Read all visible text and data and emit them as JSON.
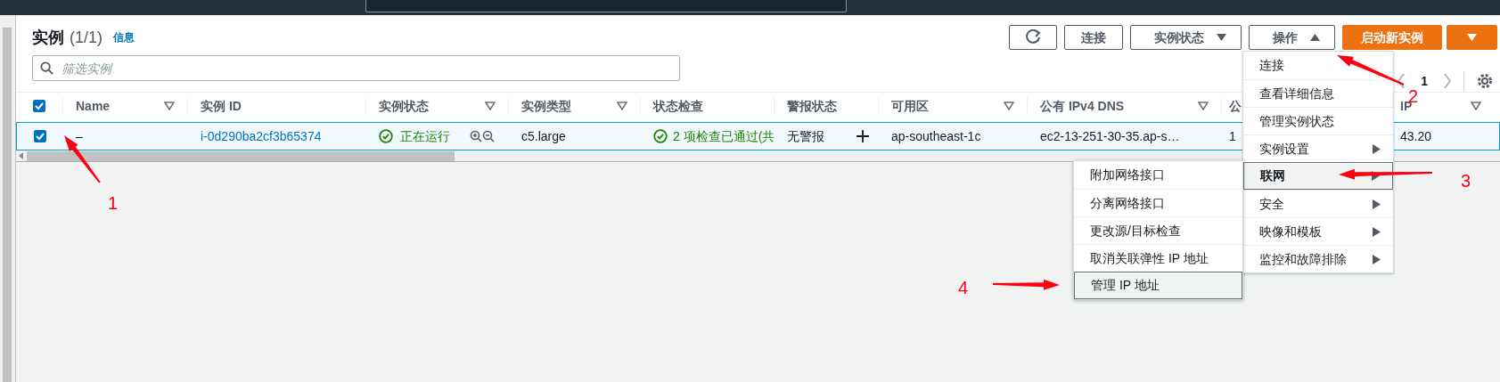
{
  "header": {
    "title": "实例",
    "count": "(1/1)",
    "info_link": "信息"
  },
  "toolbar": {
    "buttons": [
      {
        "kind": "refresh"
      },
      {
        "kind": "text",
        "label": "连接"
      },
      {
        "kind": "dropdown",
        "label": "实例状态",
        "expanded": false
      },
      {
        "kind": "dropdown",
        "label": "操作",
        "expanded": true
      },
      {
        "kind": "primary",
        "label": "启动新实例"
      },
      {
        "kind": "primary-caret"
      }
    ]
  },
  "filter": {
    "placeholder": "筛选实例"
  },
  "pagination": {
    "page": "1"
  },
  "table": {
    "select_all_checked": true,
    "columns": [
      {
        "label": "Name",
        "filter": true
      },
      {
        "label": "实例 ID",
        "filter": false
      },
      {
        "label": "实例状态",
        "filter": true
      },
      {
        "label": "实例类型",
        "filter": true
      },
      {
        "label": "状态检查",
        "filter": false
      },
      {
        "label": "警报状态",
        "filter": false
      },
      {
        "label": "可用区",
        "filter": true
      },
      {
        "label": "公有 IPv4 DNS",
        "filter": true
      },
      {
        "label": "公"
      },
      {
        "label": "IP",
        "filter": true
      }
    ],
    "rows": [
      {
        "selected": true,
        "cells": [
          {
            "kind": "text",
            "text": "–"
          },
          {
            "kind": "link",
            "text": "i-0d290ba2cf3b65374"
          },
          {
            "kind": "state",
            "text": "正在运行"
          },
          {
            "kind": "text",
            "text": "c5.large"
          },
          {
            "kind": "check",
            "text": "2 项检查已通过(共"
          },
          {
            "kind": "alarm",
            "text": "无警报"
          },
          {
            "kind": "text",
            "text": "ap-southeast-1c"
          },
          {
            "kind": "text",
            "text": "ec2-13-251-30-35.ap-s…"
          },
          {
            "kind": "text",
            "text": "1"
          },
          {
            "kind": "text",
            "text": "43.20"
          }
        ]
      }
    ]
  },
  "actions_menu": {
    "items": [
      {
        "label": "连接",
        "submenu": false,
        "selected": false
      },
      {
        "label": "查看详细信息",
        "submenu": false,
        "selected": false
      },
      {
        "label": "管理实例状态",
        "submenu": false,
        "selected": false
      },
      {
        "label": "实例设置",
        "submenu": true,
        "selected": false
      },
      {
        "label": "联网",
        "submenu": true,
        "selected": true
      },
      {
        "label": "安全",
        "submenu": true,
        "selected": false
      },
      {
        "label": "映像和模板",
        "submenu": true,
        "selected": false
      },
      {
        "label": "监控和故障排除",
        "submenu": true,
        "selected": false
      }
    ]
  },
  "networking_submenu": {
    "items": [
      {
        "label": "附加网络接口",
        "selected": false
      },
      {
        "label": "分离网络接口",
        "selected": false
      },
      {
        "label": "更改源/目标检查",
        "selected": false
      },
      {
        "label": "取消关联弹性 IP 地址",
        "selected": false
      },
      {
        "label": "管理 IP 地址",
        "selected": true
      }
    ]
  },
  "annotations": [
    {
      "label": "1"
    },
    {
      "label": "2"
    },
    {
      "label": "3"
    },
    {
      "label": "4"
    }
  ]
}
